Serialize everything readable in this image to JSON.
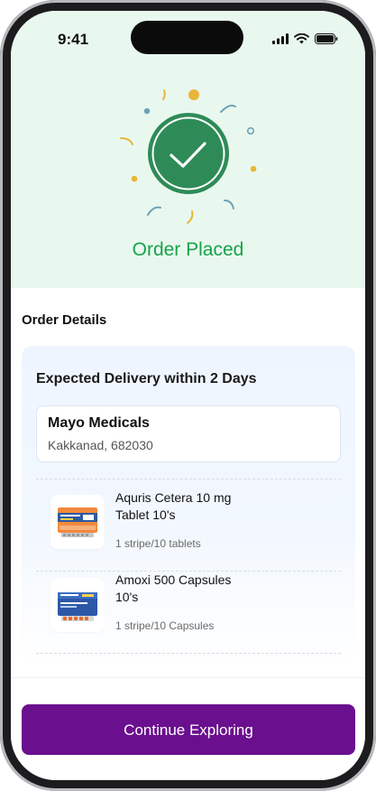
{
  "status_bar": {
    "time": "9:41",
    "icons": [
      "cellular-signal-icon",
      "wifi-icon",
      "battery-icon"
    ]
  },
  "success": {
    "title": "Order Placed",
    "icon": "check-circle-icon",
    "colors": {
      "background": "#e9f8ee",
      "check": "#2e8b57",
      "title": "#16a34a",
      "confetti_yellow": "#e9b53a",
      "confetti_blue": "#6ba2b8"
    }
  },
  "order_details": {
    "section_title": "Order Details",
    "delivery_text": "Expected Delivery within 2 Days",
    "store": {
      "name": "Mayo Medicals",
      "address": "Kakkanad, 682030"
    },
    "items": [
      {
        "name_line1": "Aquris Cetera 10 mg",
        "name_line2": "Tablet 10's",
        "quantity": "1 stripe/10 tablets",
        "icon": "medicine-box-icon"
      },
      {
        "name_line1": "Amoxi 500 Capsules",
        "name_line2": "10's",
        "quantity": "1 stripe/10 Capsules",
        "icon": "medicine-box-icon"
      }
    ]
  },
  "cta": {
    "label": "Continue Exploring",
    "color": "#6a0f8e"
  }
}
